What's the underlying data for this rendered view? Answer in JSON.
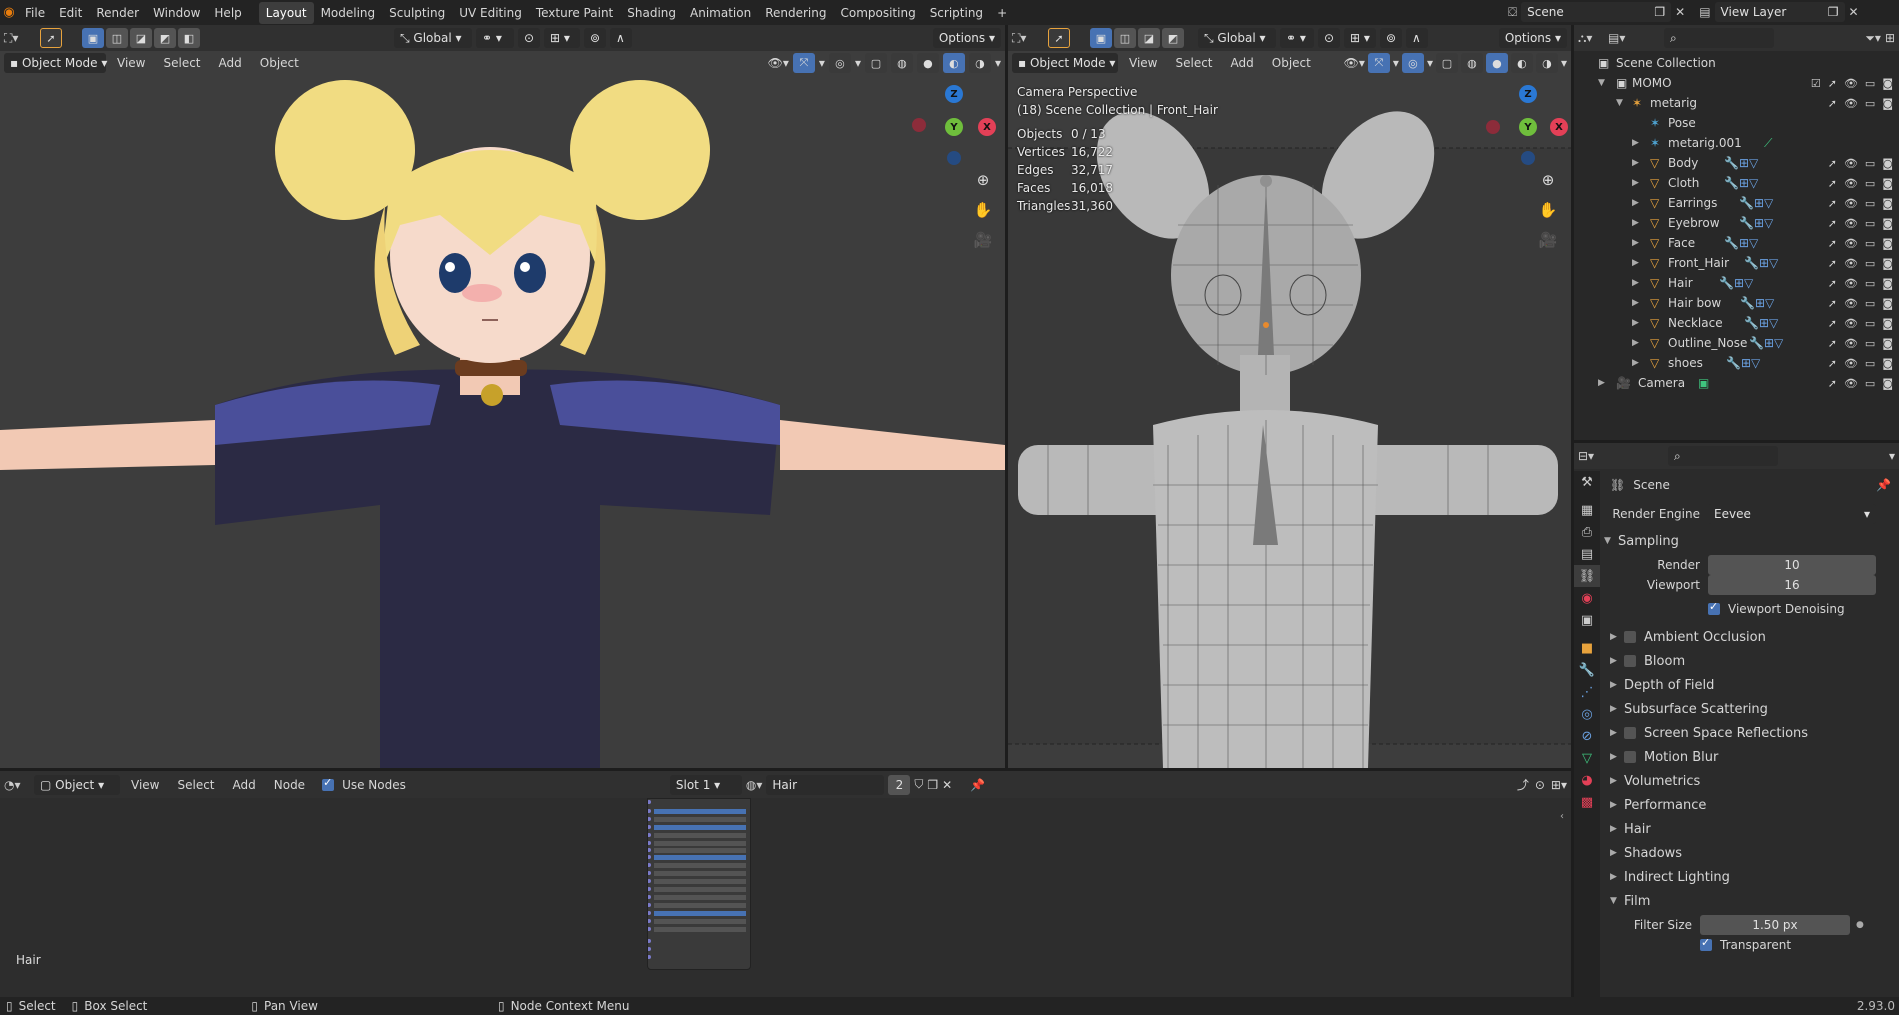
{
  "topbar": {
    "menus": [
      "File",
      "Edit",
      "Render",
      "Window",
      "Help"
    ],
    "workspaces": [
      "Layout",
      "Modeling",
      "Sculpting",
      "UV Editing",
      "Texture Paint",
      "Shading",
      "Animation",
      "Rendering",
      "Compositing",
      "Scripting"
    ],
    "active_workspace": "Layout",
    "add_tab": "+",
    "scene": "Scene",
    "view_layer": "View Layer"
  },
  "left_viewport": {
    "mode": "Object Mode",
    "menus": [
      "View",
      "Select",
      "Add",
      "Object"
    ],
    "orientation": "Global",
    "options": "Options"
  },
  "right_viewport": {
    "mode": "Object Mode",
    "menus": [
      "View",
      "Select",
      "Add",
      "Object"
    ],
    "orientation": "Global",
    "options": "Options",
    "overlay_title": "Camera Perspective",
    "overlay_subtitle": "(18) Scene Collection | Front_Hair",
    "stats": [
      {
        "label": "Objects",
        "value": "0 / 13"
      },
      {
        "label": "Vertices",
        "value": "16,722"
      },
      {
        "label": "Edges",
        "value": "32,717"
      },
      {
        "label": "Faces",
        "value": "16,018"
      },
      {
        "label": "Triangles",
        "value": "31,360"
      }
    ]
  },
  "node_editor": {
    "editor_type": "Object",
    "menus": [
      "View",
      "Select",
      "Add",
      "Node"
    ],
    "use_nodes_label": "Use Nodes",
    "slot": "Slot 1",
    "material": "Hair",
    "users": "2",
    "frame_label": "Hair"
  },
  "outliner": {
    "root": "Scene Collection",
    "collection": "MOMO",
    "armature": "metarig",
    "items": [
      {
        "name": "Pose",
        "indent": 3
      },
      {
        "name": "metarig.001",
        "indent": 2
      },
      {
        "name": "Body",
        "indent": 2
      },
      {
        "name": "Cloth",
        "indent": 2
      },
      {
        "name": "Earrings",
        "indent": 2
      },
      {
        "name": "Eyebrow",
        "indent": 2
      },
      {
        "name": "Face",
        "indent": 2
      },
      {
        "name": "Front_Hair",
        "indent": 2
      },
      {
        "name": "Hair",
        "indent": 2
      },
      {
        "name": "Hair bow",
        "indent": 2
      },
      {
        "name": "Necklace",
        "indent": 2
      },
      {
        "name": "Outline_Nose",
        "indent": 2
      },
      {
        "name": "shoes",
        "indent": 2
      }
    ],
    "camera": "Camera"
  },
  "properties": {
    "context": "Scene",
    "render_engine_label": "Render Engine",
    "render_engine": "Eevee",
    "sampling": {
      "title": "Sampling",
      "render_label": "Render",
      "render_value": "10",
      "viewport_label": "Viewport",
      "viewport_value": "16",
      "denoise_label": "Viewport Denoising"
    },
    "panels": [
      {
        "name": "Ambient Occlusion",
        "checkbox": true
      },
      {
        "name": "Bloom",
        "checkbox": true
      },
      {
        "name": "Depth of Field",
        "checkbox": false
      },
      {
        "name": "Subsurface Scattering",
        "checkbox": false
      },
      {
        "name": "Screen Space Reflections",
        "checkbox": true
      },
      {
        "name": "Motion Blur",
        "checkbox": true
      },
      {
        "name": "Volumetrics",
        "checkbox": false
      },
      {
        "name": "Performance",
        "checkbox": false
      },
      {
        "name": "Hair",
        "checkbox": false
      },
      {
        "name": "Shadows",
        "checkbox": false
      },
      {
        "name": "Indirect Lighting",
        "checkbox": false
      }
    ],
    "film": {
      "title": "Film",
      "filter_label": "Filter Size",
      "filter_value": "1.50 px",
      "transparent_label": "Transparent"
    }
  },
  "statusbar": {
    "select": "Select",
    "box_select": "Box Select",
    "pan_view": "Pan View",
    "context_menu": "Node Context Menu",
    "version": "2.93.0"
  },
  "colors": {
    "accent": "#4772b3",
    "header": "#303030",
    "viewport_bg": "#3d3d3d",
    "panel_bg": "#303030"
  }
}
